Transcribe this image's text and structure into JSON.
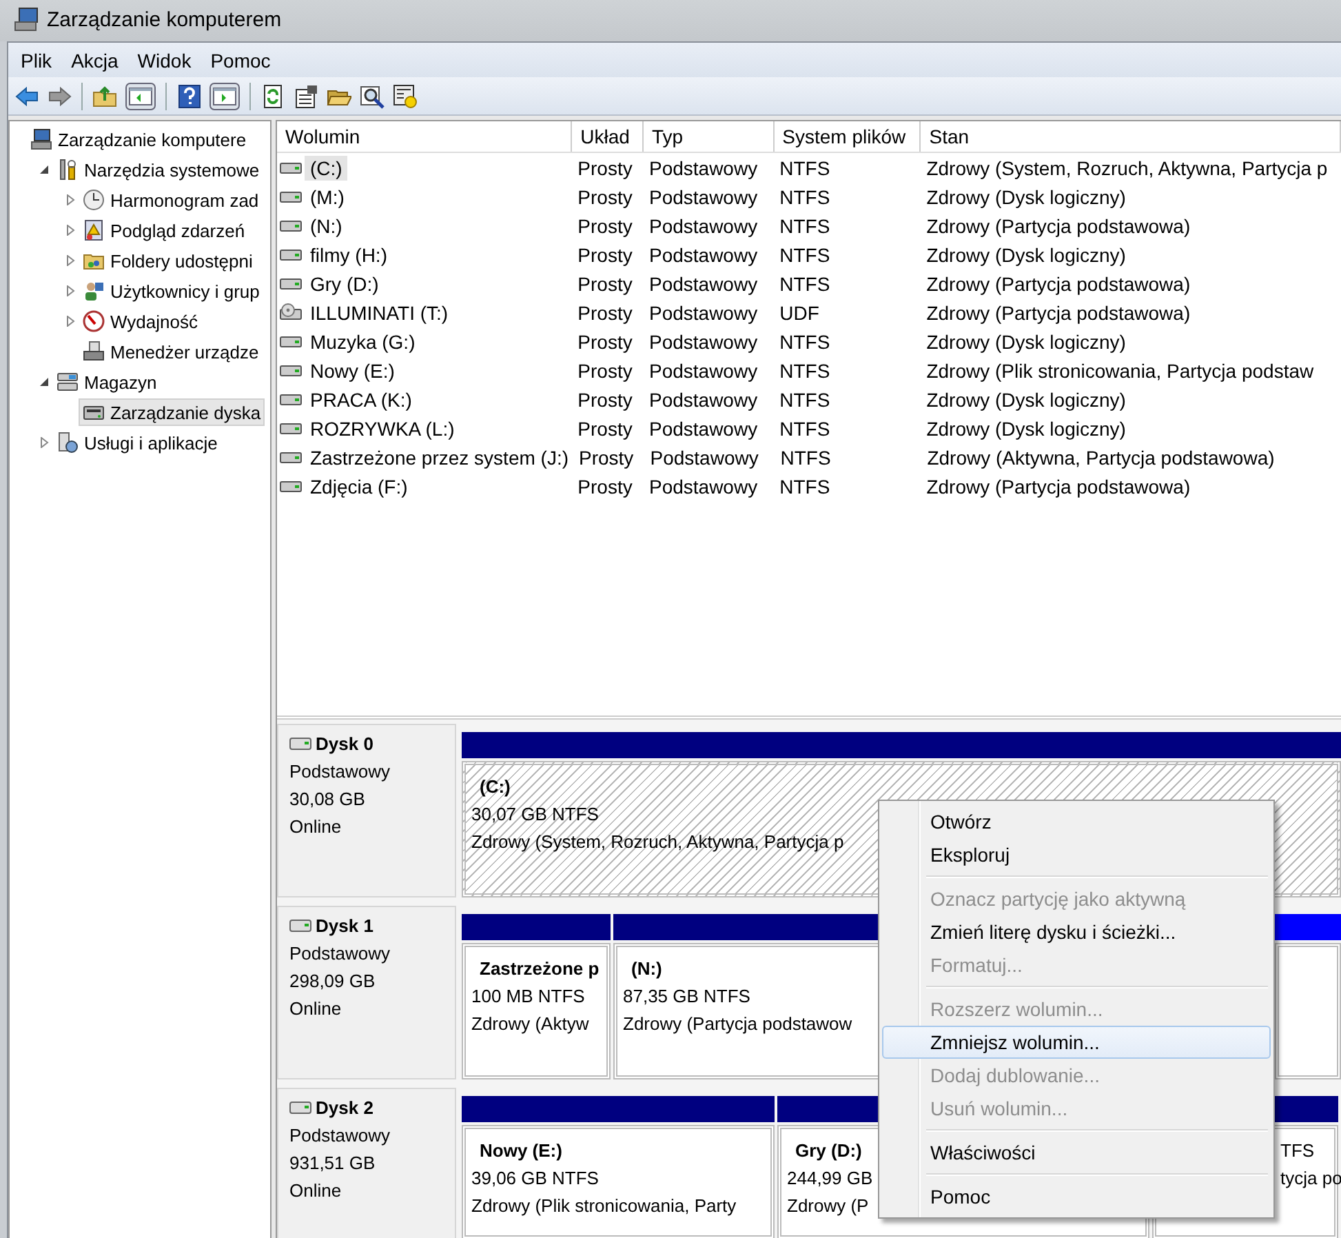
{
  "window": {
    "title": "Zarządzanie komputerem"
  },
  "menu_bar": [
    "Plik",
    "Akcja",
    "Widok",
    "Pomoc"
  ],
  "tree": [
    {
      "label": "Zarządzanie komputere",
      "kind": "leaf",
      "selected": false,
      "children": [
        {
          "label": "Narzędzia systemowe",
          "kind": "branch",
          "expanded": true,
          "selected": false,
          "children": [
            {
              "label": "Harmonogram zad",
              "kind": "branch",
              "expanded": false,
              "selected": false
            },
            {
              "label": "Podgląd zdarzeń",
              "kind": "branch",
              "expanded": false,
              "selected": false
            },
            {
              "label": "Foldery udostępni",
              "kind": "branch",
              "expanded": false,
              "selected": false
            },
            {
              "label": "Użytkownicy i grup",
              "kind": "branch",
              "expanded": false,
              "selected": false
            },
            {
              "label": "Wydajność",
              "kind": "branch",
              "expanded": false,
              "selected": false
            },
            {
              "label": "Menedżer urządze",
              "kind": "leaf",
              "selected": false
            }
          ]
        },
        {
          "label": "Magazyn",
          "kind": "branch",
          "expanded": true,
          "selected": false,
          "children": [
            {
              "label": "Zarządzanie dyska",
              "kind": "leaf",
              "selected": true
            }
          ]
        },
        {
          "label": "Usługi i aplikacje",
          "kind": "branch",
          "expanded": false,
          "selected": false
        }
      ]
    }
  ],
  "volumes": {
    "columns": [
      "Wolumin",
      "Układ",
      "Typ",
      "System plików",
      "Stan"
    ],
    "rows": [
      {
        "cells": [
          "(C:)",
          "Prosty",
          "Podstawowy",
          "NTFS",
          "Zdrowy (System, Rozruch, Aktywna, Partycja p"
        ],
        "selected": true,
        "kind": "disk"
      },
      {
        "cells": [
          "(M:)",
          "Prosty",
          "Podstawowy",
          "NTFS",
          "Zdrowy (Dysk logiczny)"
        ],
        "selected": false,
        "kind": "disk"
      },
      {
        "cells": [
          "(N:)",
          "Prosty",
          "Podstawowy",
          "NTFS",
          "Zdrowy (Partycja podstawowa)"
        ],
        "selected": false,
        "kind": "disk"
      },
      {
        "cells": [
          "filmy (H:)",
          "Prosty",
          "Podstawowy",
          "NTFS",
          "Zdrowy (Dysk logiczny)"
        ],
        "selected": false,
        "kind": "disk"
      },
      {
        "cells": [
          "Gry (D:)",
          "Prosty",
          "Podstawowy",
          "NTFS",
          "Zdrowy (Partycja podstawowa)"
        ],
        "selected": false,
        "kind": "disk"
      },
      {
        "cells": [
          "ILLUMINATI (T:)",
          "Prosty",
          "Podstawowy",
          "UDF",
          "Zdrowy (Partycja podstawowa)"
        ],
        "selected": false,
        "kind": "optical"
      },
      {
        "cells": [
          "Muzyka (G:)",
          "Prosty",
          "Podstawowy",
          "NTFS",
          "Zdrowy (Dysk logiczny)"
        ],
        "selected": false,
        "kind": "disk"
      },
      {
        "cells": [
          "Nowy (E:)",
          "Prosty",
          "Podstawowy",
          "NTFS",
          "Zdrowy (Plik stronicowania, Partycja podstaw"
        ],
        "selected": false,
        "kind": "disk"
      },
      {
        "cells": [
          "PRACA (K:)",
          "Prosty",
          "Podstawowy",
          "NTFS",
          "Zdrowy (Dysk logiczny)"
        ],
        "selected": false,
        "kind": "disk"
      },
      {
        "cells": [
          "ROZRYWKA (L:)",
          "Prosty",
          "Podstawowy",
          "NTFS",
          "Zdrowy (Dysk logiczny)"
        ],
        "selected": false,
        "kind": "disk"
      },
      {
        "cells": [
          "Zastrzeżone przez system (J:)",
          "Prosty",
          "Podstawowy",
          "NTFS",
          "Zdrowy (Aktywna, Partycja podstawowa)"
        ],
        "selected": false,
        "kind": "disk"
      },
      {
        "cells": [
          "Zdjęcia (F:)",
          "Prosty",
          "Podstawowy",
          "NTFS",
          "Zdrowy (Partycja podstawowa)"
        ],
        "selected": false,
        "kind": "disk"
      }
    ]
  },
  "disks": [
    {
      "name": "Dysk 0",
      "type": "Podstawowy",
      "size": "30,08 GB",
      "status": "Online",
      "partitions": [
        {
          "label": "(C:)",
          "size": "30,07 GB NTFS",
          "status": "Zdrowy (System, Rozruch, Aktywna, Partycja p",
          "color": "#000080",
          "selected": true
        }
      ]
    },
    {
      "name": "Dysk 1",
      "type": "Podstawowy",
      "size": "298,09 GB",
      "status": "Online",
      "partitions": [
        {
          "label": "Zastrzeżone p",
          "size": "100 MB NTFS",
          "status": "Zdrowy (Aktyw",
          "color": "#000080",
          "selected": false
        },
        {
          "label": "(N:)",
          "size": "87,35 GB NTFS",
          "status": "Zdrowy (Partycja podstawow",
          "color": "#000080",
          "selected": false
        },
        {
          "color": "#0000ff",
          "selected": false
        }
      ]
    },
    {
      "name": "Dysk 2",
      "type": "Podstawowy",
      "size": "931,51 GB",
      "status": "Online",
      "partitions": [
        {
          "label": "Nowy  (E:)",
          "size": "39,06 GB NTFS",
          "status": "Zdrowy (Plik stronicowania, Party",
          "color": "#000080",
          "selected": false
        },
        {
          "label": "Gry  (D:)",
          "size": "244,99 GB",
          "status": "Zdrowy (P",
          "color": "#000080",
          "selected": false
        },
        {
          "size": "TFS",
          "status": "tycja po",
          "color": "#000080",
          "selected": false
        }
      ]
    }
  ],
  "context_menu": {
    "items": [
      {
        "kind": "item",
        "label": "Otwórz",
        "disabled": false,
        "selected": false
      },
      {
        "kind": "item",
        "label": "Eksploruj",
        "disabled": false,
        "selected": false
      },
      {
        "kind": "separator"
      },
      {
        "kind": "item",
        "label": "Oznacz partycję jako aktywną",
        "disabled": true,
        "selected": false
      },
      {
        "kind": "item",
        "label": "Zmień literę dysku i ścieżki...",
        "disabled": false,
        "selected": false
      },
      {
        "kind": "item",
        "label": "Formatuj...",
        "disabled": true,
        "selected": false
      },
      {
        "kind": "separator"
      },
      {
        "kind": "item",
        "label": "Rozszerz wolumin...",
        "disabled": true,
        "selected": false
      },
      {
        "kind": "item",
        "label": "Zmniejsz wolumin...",
        "disabled": false,
        "selected": true
      },
      {
        "kind": "item",
        "label": "Dodaj dublowanie...",
        "disabled": true,
        "selected": false
      },
      {
        "kind": "item",
        "label": "Usuń wolumin...",
        "disabled": true,
        "selected": false
      },
      {
        "kind": "separator"
      },
      {
        "kind": "item",
        "label": "Właściwości",
        "disabled": false,
        "selected": false
      },
      {
        "kind": "separator"
      },
      {
        "kind": "item",
        "label": "Pomoc",
        "disabled": false,
        "selected": false
      }
    ]
  }
}
